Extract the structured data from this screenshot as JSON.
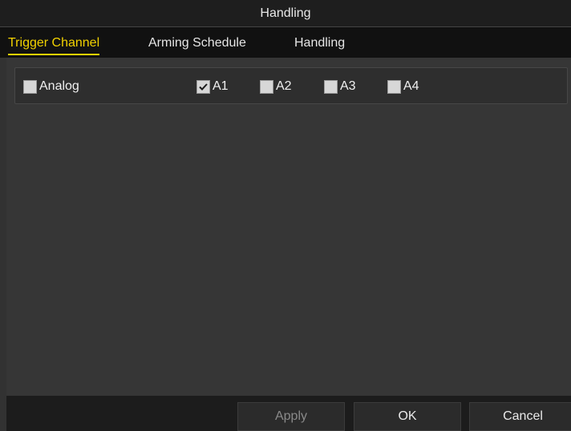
{
  "window": {
    "title": "Handling"
  },
  "tabs": [
    {
      "label": "Trigger Channel",
      "active": true
    },
    {
      "label": "Arming Schedule",
      "active": false
    },
    {
      "label": "Handling",
      "active": false
    }
  ],
  "channels": {
    "analog": {
      "label": "Analog",
      "checked": false
    },
    "items": [
      {
        "label": "A1",
        "checked": true
      },
      {
        "label": "A2",
        "checked": false
      },
      {
        "label": "A3",
        "checked": false
      },
      {
        "label": "A4",
        "checked": false
      }
    ]
  },
  "buttons": {
    "apply": "Apply",
    "ok": "OK",
    "cancel": "Cancel"
  },
  "colors": {
    "active_tab": "#f2d200",
    "background": "#323232",
    "title_bar": "#1e1e1e"
  },
  "icons": {
    "checkmark": "checkmark-icon"
  }
}
